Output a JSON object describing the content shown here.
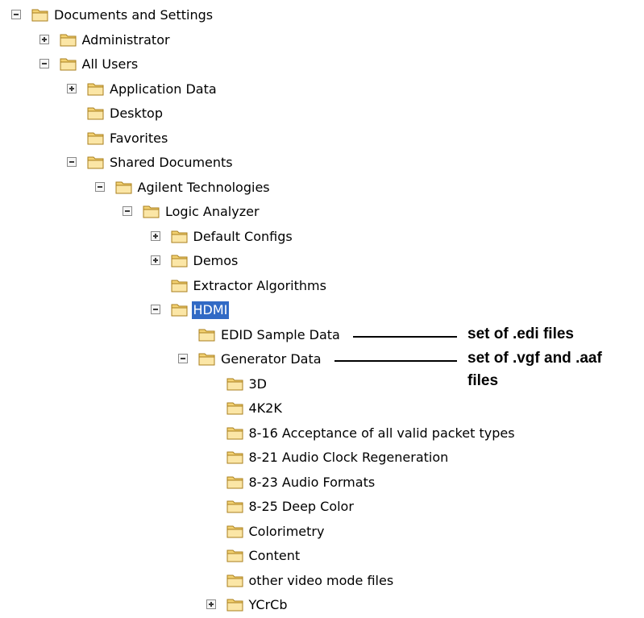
{
  "tree": [
    {
      "label": "Documents and Settings",
      "depth": 0,
      "expander": "minus"
    },
    {
      "label": "Administrator",
      "depth": 1,
      "expander": "plus"
    },
    {
      "label": "All Users",
      "depth": 1,
      "expander": "minus"
    },
    {
      "label": "Application Data",
      "depth": 2,
      "expander": "plus"
    },
    {
      "label": "Desktop",
      "depth": 2,
      "expander": null
    },
    {
      "label": "Favorites",
      "depth": 2,
      "expander": null
    },
    {
      "label": "Shared Documents",
      "depth": 2,
      "expander": "minus"
    },
    {
      "label": "Agilent Technologies",
      "depth": 3,
      "expander": "minus"
    },
    {
      "label": "Logic Analyzer",
      "depth": 4,
      "expander": "minus"
    },
    {
      "label": "Default Configs",
      "depth": 5,
      "expander": "plus"
    },
    {
      "label": "Demos",
      "depth": 5,
      "expander": "plus"
    },
    {
      "label": "Extractor Algorithms",
      "depth": 5,
      "expander": null
    },
    {
      "label": "HDMI",
      "depth": 5,
      "expander": "minus",
      "selected": true
    },
    {
      "label": "EDID Sample Data",
      "depth": 6,
      "expander": null
    },
    {
      "label": "Generator Data",
      "depth": 6,
      "expander": "minus"
    },
    {
      "label": "3D",
      "depth": 7,
      "expander": null
    },
    {
      "label": "4K2K",
      "depth": 7,
      "expander": null
    },
    {
      "label": "8-16 Acceptance of all valid packet types",
      "depth": 7,
      "expander": null
    },
    {
      "label": "8-21 Audio Clock Regeneration",
      "depth": 7,
      "expander": null
    },
    {
      "label": "8-23 Audio Formats",
      "depth": 7,
      "expander": null
    },
    {
      "label": "8-25 Deep Color",
      "depth": 7,
      "expander": null
    },
    {
      "label": "Colorimetry",
      "depth": 7,
      "expander": null
    },
    {
      "label": "Content",
      "depth": 7,
      "expander": null
    },
    {
      "label": "other video mode files",
      "depth": 7,
      "expander": null
    },
    {
      "label": "YCrCb",
      "depth": 7,
      "expander": "plus"
    }
  ],
  "annotations": [
    {
      "text": "set of .edi files",
      "row": 13
    },
    {
      "text": "set of .vgf and .aaf\nfiles",
      "row": 14
    }
  ],
  "colors": {
    "selection": "#316ac5",
    "folder_fill": "#f3d273",
    "folder_stroke": "#a97f1d"
  },
  "icon": "folder-icon"
}
